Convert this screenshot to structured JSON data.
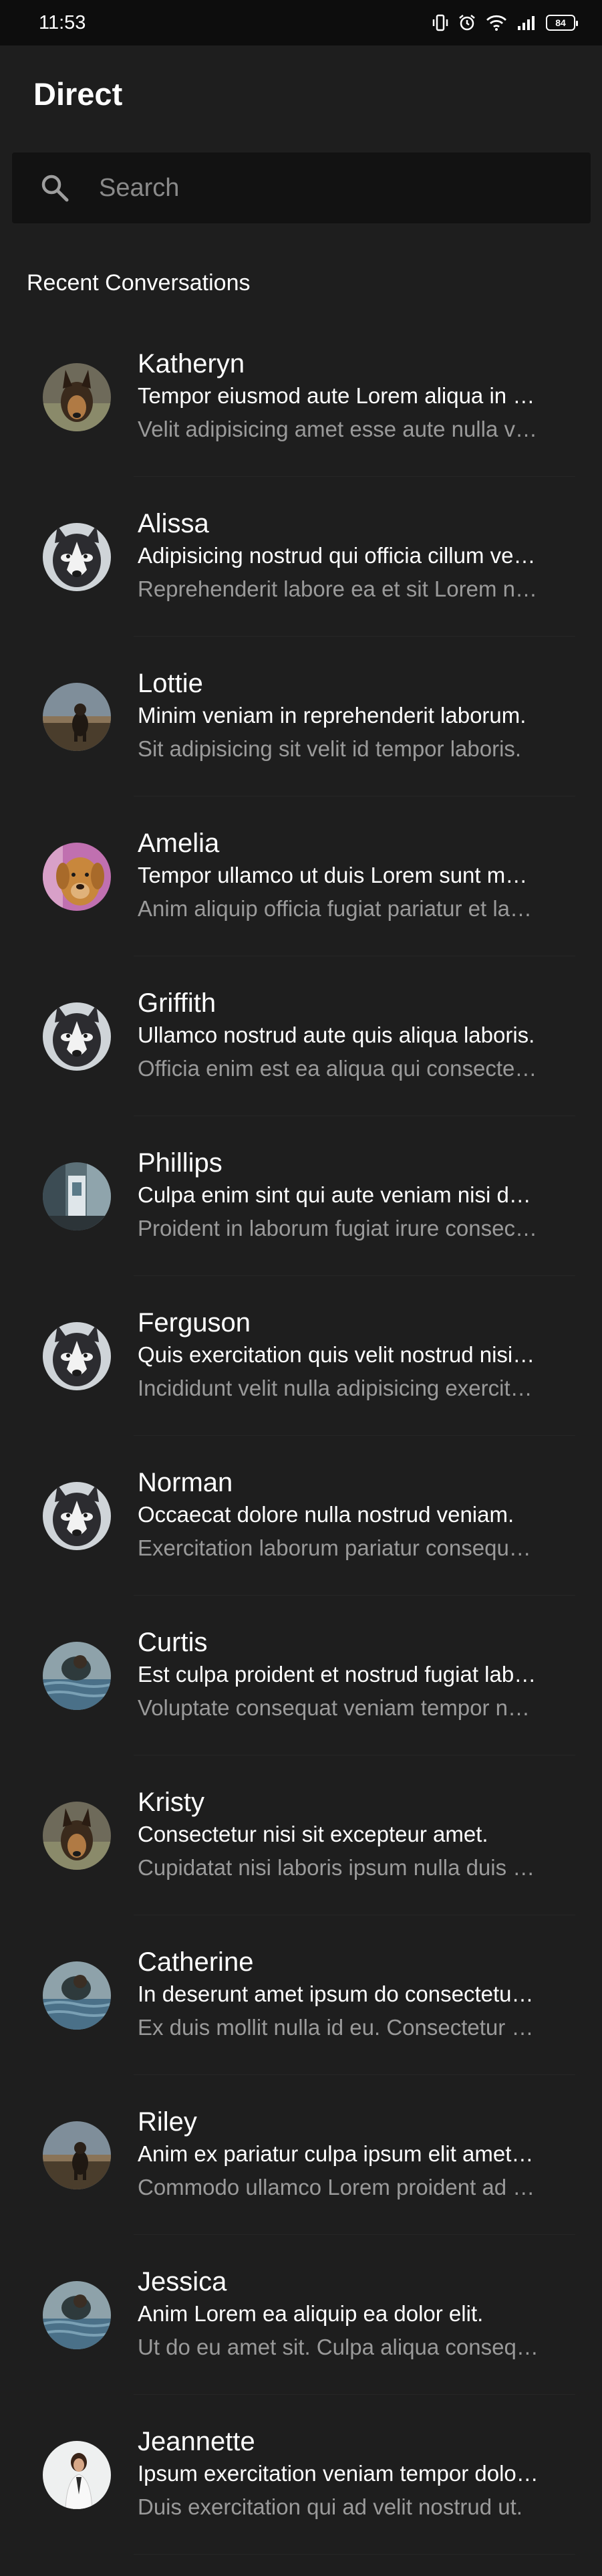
{
  "status_bar": {
    "time": "11:53",
    "battery": "84",
    "icons": [
      "vibrate-icon",
      "alarm-icon",
      "wifi-icon",
      "signal-icon",
      "battery-icon"
    ]
  },
  "header": {
    "title": "Direct"
  },
  "search": {
    "placeholder": "Search",
    "icon": "search-icon"
  },
  "section": {
    "title": "Recent Conversations"
  },
  "conversations": [
    {
      "name": "Katheryn",
      "line1": "Tempor eiusmod aute Lorem aliqua in excepteur.",
      "line2": "Velit adipisicing amet esse aute nulla veniam.",
      "avatar": "german-shepherd"
    },
    {
      "name": "Alissa",
      "line1": "Adipisicing nostrud qui officia cillum veniam.",
      "line2": "Reprehenderit labore ea et sit Lorem nostrud.",
      "avatar": "husky"
    },
    {
      "name": "Lottie",
      "line1": "Minim veniam in reprehenderit laborum.",
      "line2": "Sit adipisicing sit velit id tempor laboris.",
      "avatar": "dog-field"
    },
    {
      "name": "Amelia",
      "line1": "Tempor ullamco ut duis Lorem sunt mollit.",
      "line2": "Anim aliquip officia fugiat pariatur et labore.",
      "avatar": "golden-retriever"
    },
    {
      "name": "Griffith",
      "line1": "Ullamco nostrud aute quis aliqua laboris.",
      "line2": "Officia enim est ea aliqua qui consectetur.",
      "avatar": "husky"
    },
    {
      "name": "Phillips",
      "line1": "Culpa enim sint qui aute veniam nisi dolor.",
      "line2": "Proident in laborum fugiat irure consectetur.",
      "avatar": "street-scene"
    },
    {
      "name": "Ferguson",
      "line1": "Quis exercitation quis velit nostrud nisi elit.",
      "line2": "Incididunt velit nulla adipisicing exercitation.",
      "avatar": "husky"
    },
    {
      "name": "Norman",
      "line1": "Occaecat dolore nulla nostrud veniam.",
      "line2": "Exercitation laborum pariatur consequat elit.",
      "avatar": "husky"
    },
    {
      "name": "Curtis",
      "line1": "Est culpa proident et nostrud fugiat laboris.",
      "line2": "Voluptate consequat veniam tempor nostrud.",
      "avatar": "person-water"
    },
    {
      "name": "Kristy",
      "line1": "Consectetur nisi sit excepteur amet.",
      "line2": "Cupidatat nisi laboris ipsum nulla duis esse.",
      "avatar": "german-shepherd"
    },
    {
      "name": "Catherine",
      "line1": "In deserunt amet ipsum do consectetur elit.",
      "line2": "Ex duis mollit nulla id eu. Consectetur elit.",
      "avatar": "person-water"
    },
    {
      "name": "Riley",
      "line1": "Anim ex pariatur culpa ipsum elit amet dolor.",
      "line2": "Commodo ullamco Lorem proident ad esse.",
      "avatar": "dog-field"
    },
    {
      "name": "Jessica",
      "line1": "Anim Lorem ea aliquip ea dolor elit.",
      "line2": "Ut do eu amet sit. Culpa aliqua consequat.",
      "avatar": "person-water"
    },
    {
      "name": "Jeannette",
      "line1": "Ipsum exercitation veniam tempor dolore.",
      "line2": "Duis exercitation qui ad velit nostrud ut.",
      "avatar": "person-white"
    }
  ]
}
